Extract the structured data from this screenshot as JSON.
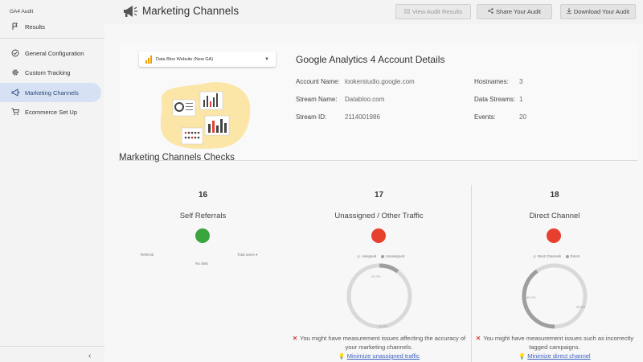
{
  "sidebar": {
    "title": "GA4 Audit",
    "items": [
      {
        "label": "Results",
        "icon": "flag-icon"
      },
      {
        "label": "General Configuration",
        "icon": "check-circle-icon"
      },
      {
        "label": "Custom Tracking",
        "icon": "gear-icon"
      },
      {
        "label": "Marketing Channels",
        "icon": "megaphone-icon"
      },
      {
        "label": "Ecommerce Set Up",
        "icon": "cart-icon"
      }
    ],
    "collapse": "‹"
  },
  "header": {
    "title": "Marketing Channels",
    "buttons": [
      {
        "label": "View Audit Results",
        "icon": "results-icon"
      },
      {
        "label": "Share Your Audit",
        "icon": "share-icon"
      },
      {
        "label": "Download Your Audit",
        "icon": "download-icon"
      }
    ]
  },
  "account": {
    "dropdown": "Data Bloo Website (New GA)",
    "title": "Google Analytics 4 Account Details",
    "account_name_label": "Account Name:",
    "account_name": "lookerstudio.google.com",
    "stream_name_label": "Stream Name:",
    "stream_name": "Databloo.com",
    "stream_id_label": "Stream ID:",
    "stream_id": "2114001986",
    "hostnames_label": "Hostnames:",
    "hostnames": "3",
    "data_streams_label": "Data Streams:",
    "data_streams": "1",
    "events_label": "Events:",
    "events": "20"
  },
  "checks": {
    "title": "Marketing Channels Checks",
    "items": [
      {
        "number": "16",
        "label": "Self Referrals",
        "status": "green",
        "col_left": "Referral",
        "col_right": "Total users ▾",
        "no_data": "No data"
      },
      {
        "number": "17",
        "label": "Unassigned / Other Traffic",
        "status": "red",
        "legend_a": "Assigned",
        "legend_b": "Unassigned",
        "pct_small": "10.2%",
        "pct_large": "89.8%",
        "msg": "You might have measurement issues affecting the accuracy of your marketing channels.",
        "link": "Minimize unassigned traffic"
      },
      {
        "number": "18",
        "label": "Direct Channel",
        "status": "red",
        "legend_a": "Rest Channels",
        "legend_b": "Direct",
        "pct_small": "40.2%",
        "pct_large": "59.8%",
        "msg": "You might have measurement issues such as incorrectly tagged campaigns.",
        "link": "Minimize direct channel"
      }
    ]
  },
  "colors": {
    "active_bg": "#d6e2f3",
    "green": "#3aa53c",
    "red": "#e8402f",
    "donut_light": "#d9d9d9",
    "donut_dark": "#9e9e9e"
  }
}
